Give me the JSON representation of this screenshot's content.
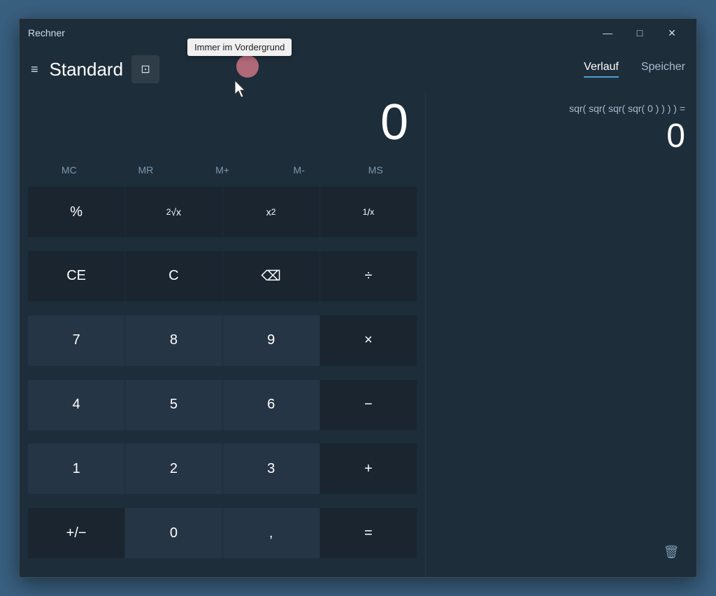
{
  "window": {
    "title": "Rechner",
    "minimize_label": "—",
    "maximize_label": "□",
    "close_label": "✕"
  },
  "tooltip": {
    "text": "Immer im Vordergrund"
  },
  "header": {
    "menu_icon": "≡",
    "title": "Standard",
    "always_on_top_icon": "⊡"
  },
  "tabs": {
    "history_label": "Verlauf",
    "memory_label": "Speicher"
  },
  "display": {
    "value": "0"
  },
  "history": {
    "expression": "sqr( sqr( sqr( sqr( 0 ) ) ) ) =",
    "result": "0"
  },
  "memory_buttons": [
    {
      "label": "MC",
      "key": "mc"
    },
    {
      "label": "MR",
      "key": "mr"
    },
    {
      "label": "M+",
      "key": "mplus"
    },
    {
      "label": "M-",
      "key": "mminus"
    },
    {
      "label": "MS",
      "key": "ms"
    }
  ],
  "buttons": [
    {
      "label": "%",
      "type": "dark",
      "key": "percent"
    },
    {
      "label": "²√x",
      "type": "dark",
      "key": "sqrt",
      "is_super": true
    },
    {
      "label": "x²",
      "type": "dark",
      "key": "square",
      "is_super": true
    },
    {
      "label": "¹/x",
      "type": "dark",
      "key": "reciprocal"
    },
    {
      "label": "CE",
      "type": "dark",
      "key": "ce"
    },
    {
      "label": "C",
      "type": "dark",
      "key": "clear"
    },
    {
      "label": "⌫",
      "type": "dark",
      "key": "backspace"
    },
    {
      "label": "÷",
      "type": "operator",
      "key": "divide"
    },
    {
      "label": "7",
      "type": "normal",
      "key": "7"
    },
    {
      "label": "8",
      "type": "normal",
      "key": "8"
    },
    {
      "label": "9",
      "type": "normal",
      "key": "9"
    },
    {
      "label": "×",
      "type": "operator",
      "key": "multiply"
    },
    {
      "label": "4",
      "type": "normal",
      "key": "4"
    },
    {
      "label": "5",
      "type": "normal",
      "key": "5"
    },
    {
      "label": "6",
      "type": "normal",
      "key": "6"
    },
    {
      "label": "−",
      "type": "operator",
      "key": "subtract"
    },
    {
      "label": "1",
      "type": "normal",
      "key": "1"
    },
    {
      "label": "2",
      "type": "normal",
      "key": "2"
    },
    {
      "label": "3",
      "type": "normal",
      "key": "3"
    },
    {
      "label": "+",
      "type": "operator",
      "key": "add"
    },
    {
      "label": "+/−",
      "type": "dark",
      "key": "negate"
    },
    {
      "label": "0",
      "type": "normal",
      "key": "0"
    },
    {
      "label": ",",
      "type": "normal",
      "key": "decimal"
    },
    {
      "label": "=",
      "type": "operator",
      "key": "equals"
    }
  ],
  "trash": {
    "icon": "🗑"
  }
}
